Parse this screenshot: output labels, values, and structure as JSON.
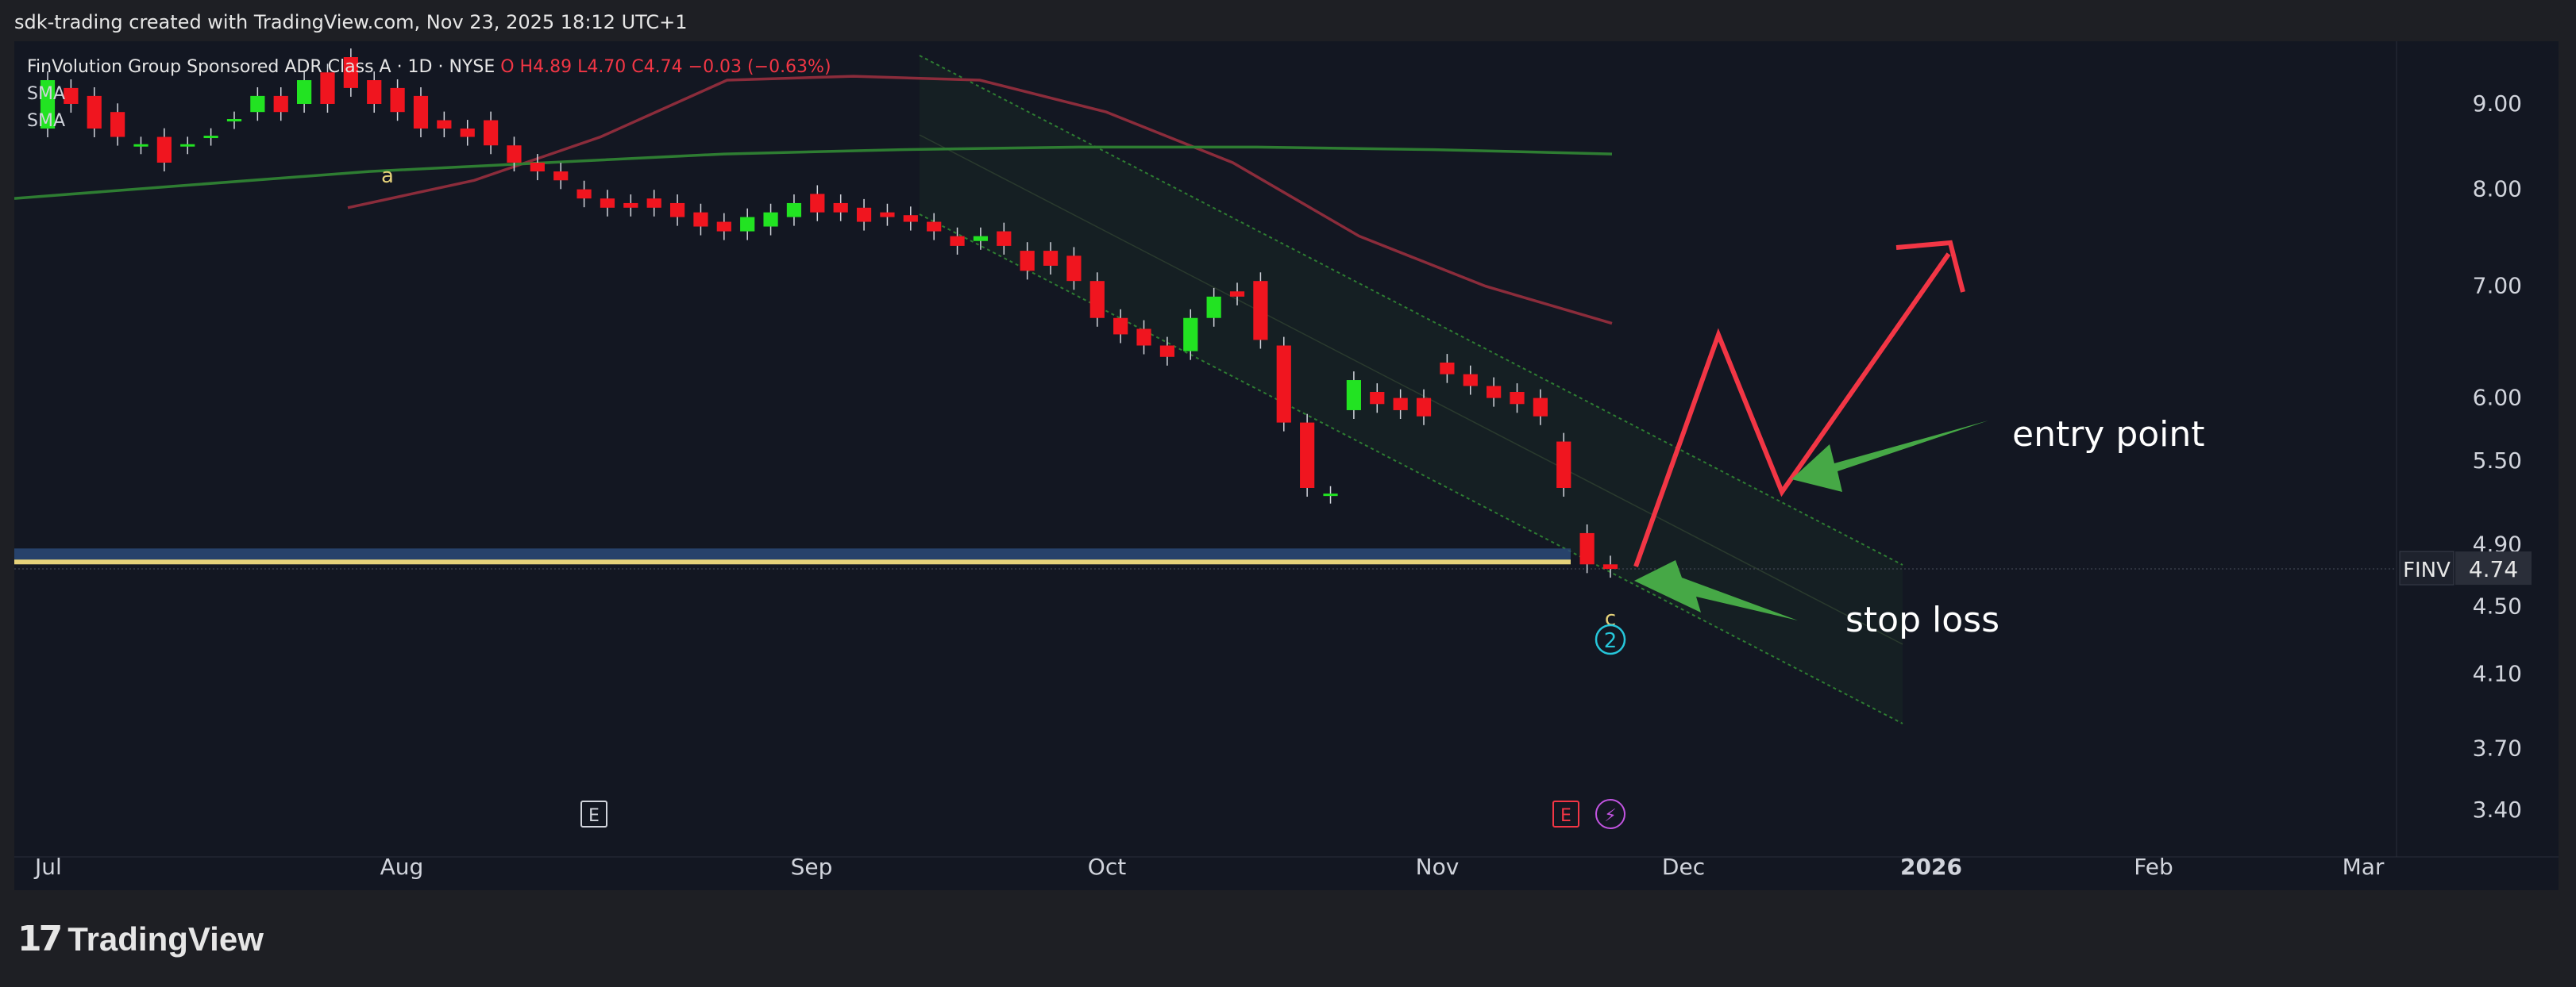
{
  "header": {
    "attribution": "sdk-trading created with TradingView.com, Nov 23, 2025 18:12 UTC+1"
  },
  "legend": {
    "title": "FinVolution Group Sponsored ADR Class A · 1D · NYSE",
    "ohlc": "O  H4.89  L4.70  C4.74  −0.03 (−0.63%)",
    "sma1": "SMA",
    "sma2": "SMA"
  },
  "footer": {
    "brand": "TradingView"
  },
  "colors": {
    "background": "#131722",
    "up_candle": "#22e322",
    "down_candle": "#f0151f",
    "sma_fast": "#8b2c3b",
    "sma_slow": "#2e7d32",
    "channel": "#2e7d32",
    "arrow": "#46a846",
    "projection": "#f23645",
    "support_band": "#e6d27a"
  },
  "chart_data": {
    "type": "candlestick",
    "symbol": "FINV",
    "last_price": "4.74",
    "y_scale": "log",
    "ylim": [
      3.25,
      9.6
    ],
    "y_ticks": [
      "9.00",
      "8.00",
      "7.00",
      "6.00",
      "5.50",
      "4.90",
      "4.50",
      "4.10",
      "3.70",
      "3.40"
    ],
    "x_ticks": [
      "Jul",
      "Aug",
      "Sep",
      "Oct",
      "Nov",
      "Dec",
      "2026",
      "Feb",
      "Mar"
    ],
    "candles_open_close": [
      [
        8.7,
        9.3
      ],
      [
        9.2,
        9.0
      ],
      [
        9.1,
        8.7
      ],
      [
        8.9,
        8.6
      ],
      [
        8.5,
        8.5
      ],
      [
        8.6,
        8.3
      ],
      [
        8.5,
        8.5
      ],
      [
        8.6,
        8.6
      ],
      [
        8.8,
        8.8
      ],
      [
        8.9,
        9.1
      ],
      [
        9.1,
        8.9
      ],
      [
        9.0,
        9.3
      ],
      [
        9.4,
        9.0
      ],
      [
        9.6,
        9.2
      ],
      [
        9.3,
        9.0
      ],
      [
        9.2,
        8.9
      ],
      [
        9.1,
        8.7
      ],
      [
        8.8,
        8.7
      ],
      [
        8.7,
        8.6
      ],
      [
        8.8,
        8.5
      ],
      [
        8.5,
        8.3
      ],
      [
        8.3,
        8.2
      ],
      [
        8.2,
        8.1
      ],
      [
        8.0,
        7.9
      ],
      [
        7.9,
        7.8
      ],
      [
        7.85,
        7.8
      ],
      [
        7.9,
        7.8
      ],
      [
        7.85,
        7.7
      ],
      [
        7.75,
        7.6
      ],
      [
        7.65,
        7.55
      ],
      [
        7.55,
        7.7
      ],
      [
        7.6,
        7.75
      ],
      [
        7.7,
        7.85
      ],
      [
        7.95,
        7.75
      ],
      [
        7.85,
        7.75
      ],
      [
        7.8,
        7.65
      ],
      [
        7.75,
        7.7
      ],
      [
        7.72,
        7.65
      ],
      [
        7.65,
        7.55
      ],
      [
        7.5,
        7.4
      ],
      [
        7.45,
        7.5
      ],
      [
        7.55,
        7.4
      ],
      [
        7.35,
        7.15
      ],
      [
        7.35,
        7.2
      ],
      [
        7.3,
        7.05
      ],
      [
        7.05,
        6.7
      ],
      [
        6.7,
        6.55
      ],
      [
        6.6,
        6.45
      ],
      [
        6.45,
        6.35
      ],
      [
        6.4,
        6.7
      ],
      [
        6.7,
        6.9
      ],
      [
        6.95,
        6.9
      ],
      [
        7.05,
        6.5
      ],
      [
        6.45,
        5.8
      ],
      [
        5.8,
        5.3
      ],
      [
        5.25,
        5.25
      ],
      [
        5.9,
        6.15
      ],
      [
        6.05,
        5.95
      ],
      [
        6.0,
        5.9
      ],
      [
        6.0,
        5.85
      ],
      [
        6.3,
        6.2
      ],
      [
        6.2,
        6.1
      ],
      [
        6.1,
        6.0
      ],
      [
        6.05,
        5.95
      ],
      [
        6.0,
        5.85
      ],
      [
        5.65,
        5.3
      ],
      [
        4.98,
        4.77
      ],
      [
        4.77,
        4.74
      ]
    ],
    "series": [
      {
        "name": "SMA",
        "values": [
          7.8,
          8.1,
          8.6,
          9.3,
          9.35,
          9.3,
          8.9,
          8.3,
          7.5,
          7.0,
          6.65
        ]
      },
      {
        "name": "SMA",
        "values": [
          7.9,
          8.05,
          8.2,
          8.3,
          8.4,
          8.45,
          8.48,
          8.48,
          8.45,
          8.4
        ]
      }
    ],
    "support_level": 4.77,
    "annotations": [
      {
        "text": "entry point",
        "kind": "arrow"
      },
      {
        "text": "stop loss",
        "kind": "arrow"
      }
    ],
    "wave_labels": [
      "a",
      "c",
      "2"
    ],
    "event_markers": [
      "E",
      "E",
      "⚡"
    ]
  }
}
